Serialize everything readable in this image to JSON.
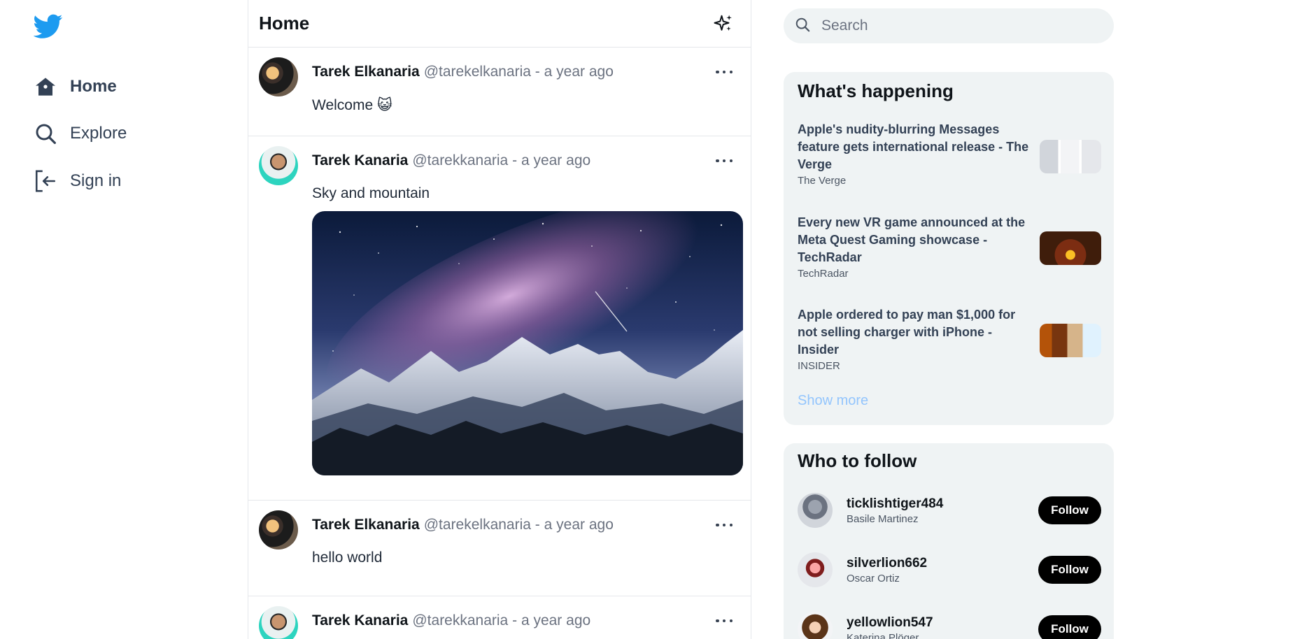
{
  "sidebar": {
    "logo": "twitter-bird-icon",
    "nav": [
      {
        "label": "Home",
        "icon": "home-icon",
        "active": true
      },
      {
        "label": "Explore",
        "icon": "search-icon",
        "active": false
      },
      {
        "label": "Sign in",
        "icon": "sign-in-icon",
        "active": false
      }
    ]
  },
  "main": {
    "title": "Home",
    "header_icon": "sparkle-icon",
    "tweets": [
      {
        "name": "Tarek Elkanaria",
        "handle": "@tarekelkanaria",
        "sep": "-",
        "time": "a year ago",
        "text": "Welcome 😺",
        "has_image": false
      },
      {
        "name": "Tarek Kanaria",
        "handle": "@tarekkanaria",
        "sep": "-",
        "time": "a year ago",
        "text": "Sky and mountain",
        "has_image": true
      },
      {
        "name": "Tarek Elkanaria",
        "handle": "@tarekelkanaria",
        "sep": "-",
        "time": "a year ago",
        "text": "hello world",
        "has_image": false
      },
      {
        "name": "Tarek Kanaria",
        "handle": "@tarekkanaria",
        "sep": "-",
        "time": "a year ago",
        "text": "",
        "has_image": false
      }
    ]
  },
  "search": {
    "placeholder": "Search",
    "value": ""
  },
  "happening": {
    "title": "What's happening",
    "items": [
      {
        "title": "Apple's nudity-blurring Messages feature gets international release - The Verge",
        "source": "The Verge"
      },
      {
        "title": "Every new VR game announced at the Meta Quest Gaming showcase - TechRadar",
        "source": "TechRadar"
      },
      {
        "title": "Apple ordered to pay man $1,000 for not selling charger with iPhone - Insider",
        "source": "INSIDER"
      }
    ],
    "show_more": "Show more"
  },
  "follow": {
    "title": "Who to follow",
    "button_label": "Follow",
    "users": [
      {
        "username": "ticklishtiger484",
        "name": "Basile Martinez"
      },
      {
        "username": "silverlion662",
        "name": "Oscar Ortiz"
      },
      {
        "username": "yellowlion547",
        "name": "Katerina Plöger"
      }
    ]
  },
  "colors": {
    "brand": "#1d9bf0",
    "follow_button": "#000000",
    "link": "#93c5fd"
  }
}
